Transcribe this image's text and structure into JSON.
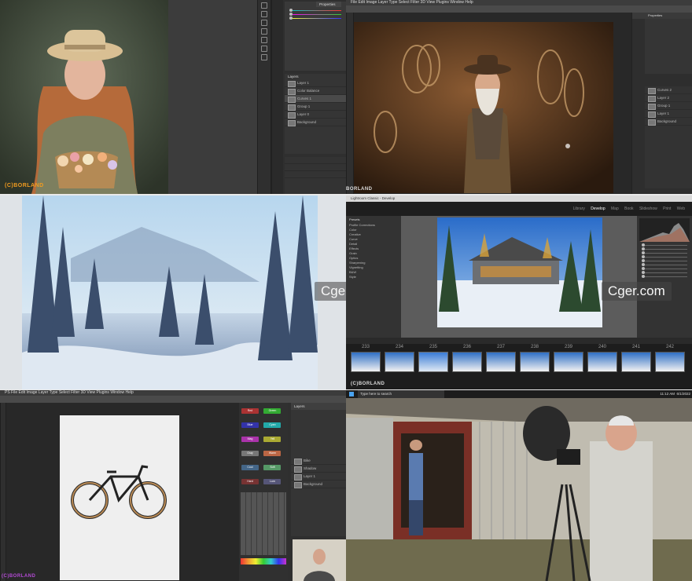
{
  "watermarks": {
    "borland_q1": "(C)BORLAND",
    "borland_q2": "BORLAND",
    "borland_q4": "(C)BORLAND",
    "borland_q5": "(C)BORLAND",
    "cger_left": "Cger.com",
    "cger_right": "Cger.com"
  },
  "photoshop_portrait": {
    "panel_tab": "Properties",
    "layers_tab": "Layers",
    "layer_names": [
      "Layer 1",
      "Color Balance",
      "Curves 1",
      "Group 1",
      "Layer 0",
      "Background"
    ]
  },
  "photoshop_cowboy": {
    "menu": "File  Edit  Image  Layer  Type  Select  Filter  3D  View  Plugins  Window  Help",
    "panel_tabs": [
      "Properties",
      "Adjustments",
      "Layers"
    ],
    "layer_names": [
      "Curves 2",
      "Layer 2",
      "Group 1",
      "Layer 1",
      "Background"
    ]
  },
  "lightroom": {
    "title": "Lightroom Classic - Develop",
    "modules": [
      "Library",
      "Develop",
      "Map",
      "Book",
      "Slideshow",
      "Print",
      "Web"
    ],
    "left_panel": "Presets",
    "preset_items": [
      "Profile Corrections",
      "Color",
      "Creative",
      "Curve",
      "Detail",
      "Effects",
      "Grain",
      "Optics",
      "Sharpening",
      "Vignetting",
      "B&W",
      "Style"
    ],
    "filmstrip_numbers": [
      "233",
      "234",
      "235",
      "236",
      "237",
      "238",
      "239",
      "240",
      "241",
      "242"
    ]
  },
  "photoshop_bike": {
    "menu": "PS  File  Edit  Image  Layer  Type  Select  Filter  3D  View  Plugins  Window  Help",
    "swatch_labels": [
      "Red",
      "Green",
      "Blue",
      "Cyan",
      "Mag",
      "Yell",
      "Gray",
      "Warm",
      "Cool",
      "Soft",
      "Hard",
      "Lum"
    ],
    "layers_tab": "Layers",
    "layer_names": [
      "Bike",
      "Shadow",
      "Layer 1",
      "Background"
    ]
  },
  "taskbar": {
    "search_placeholder": "Type here to search",
    "time": "11:12 AM",
    "date": "6/1/2022"
  },
  "colors": {
    "watermark_orange": "#f29c1f",
    "ps_panel": "#3b3b3b",
    "lr_selected": "#6a6a6a"
  }
}
